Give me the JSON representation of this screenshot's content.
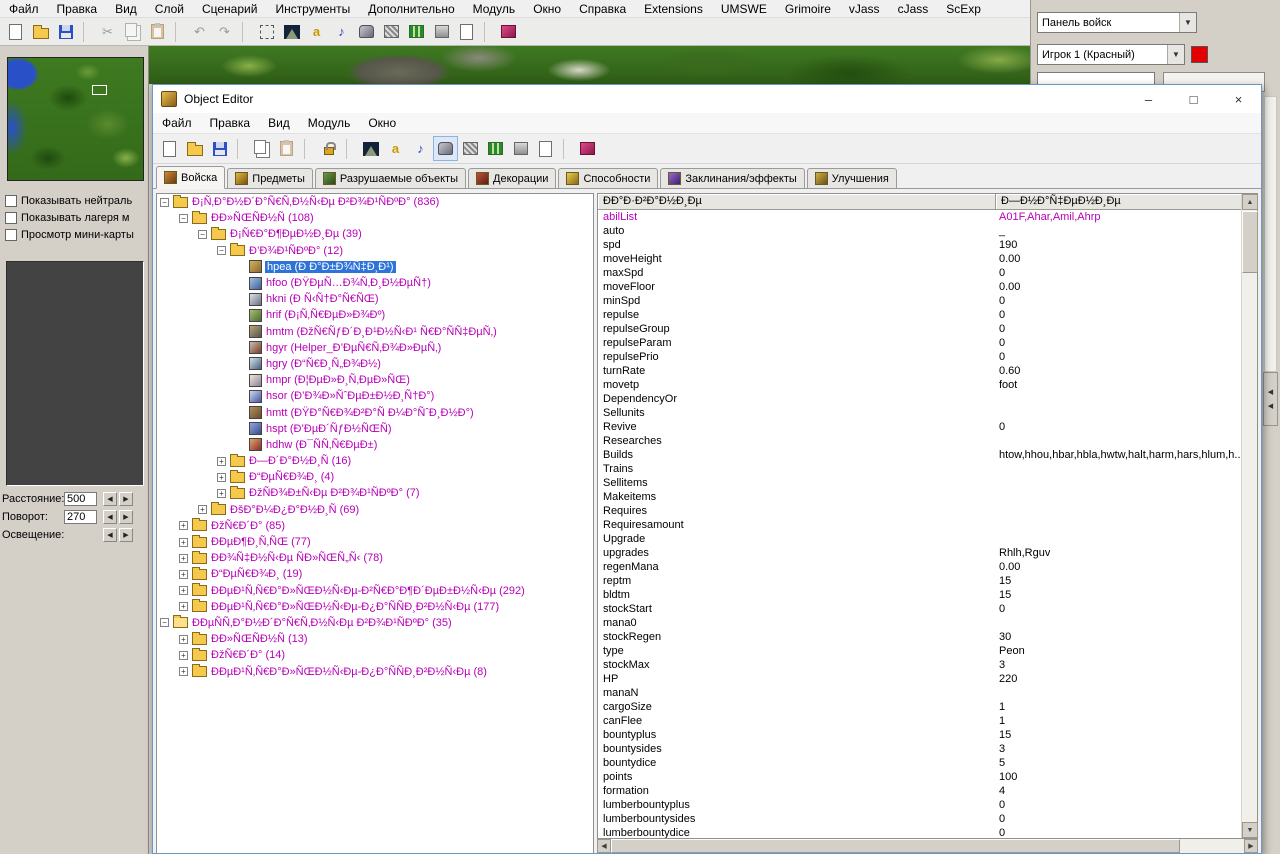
{
  "icons": {
    "dropdown": "▼",
    "minimize": "–",
    "maximize": "□",
    "close": "×",
    "scroll_up": "▲",
    "scroll_down": "▼",
    "scroll_left": "◀",
    "scroll_right": "▶",
    "spin_left": "◀",
    "spin_right": "▶",
    "expand_plus": "+",
    "expand_minus": "−"
  },
  "main_menu": {
    "items": [
      "Файл",
      "Правка",
      "Вид",
      "Слой",
      "Сценарий",
      "Инструменты",
      "Дополнительно",
      "Модуль",
      "Окно",
      "Справка",
      "Extensions",
      "UMSWE",
      "Grimoire",
      "vJass",
      "cJass",
      "ScExp"
    ]
  },
  "main_toolbar": [
    {
      "name": "new-document-icon",
      "kind": "page"
    },
    {
      "name": "open-folder-icon",
      "kind": "folder"
    },
    {
      "name": "save-icon",
      "kind": "floppy"
    },
    {
      "sep": true
    },
    {
      "name": "cut-icon",
      "kind": "glyph",
      "glyph": "✂",
      "color": "#9a9a9a"
    },
    {
      "name": "copy-icon",
      "kind": "copy",
      "dim": true
    },
    {
      "name": "paste-icon",
      "kind": "paste",
      "dim": true
    },
    {
      "sep": true
    },
    {
      "name": "undo-icon",
      "kind": "glyph",
      "glyph": "↶",
      "color": "#9a9a9a"
    },
    {
      "name": "redo-icon",
      "kind": "glyph",
      "glyph": "↷",
      "color": "#9a9a9a"
    },
    {
      "sep": true
    },
    {
      "name": "selection-frame-icon",
      "kind": "dash"
    },
    {
      "name": "terrain-palette-icon",
      "kind": "mountain"
    },
    {
      "name": "trigger-editor-icon",
      "kind": "glyph",
      "glyph": "a",
      "color": "#c89a00",
      "bold": true
    },
    {
      "name": "sound-editor-icon",
      "kind": "glyph",
      "glyph": "♪",
      "color": "#2a4ac0"
    },
    {
      "name": "object-editor-icon",
      "kind": "helmet"
    },
    {
      "name": "campaign-editor-icon",
      "kind": "rails"
    },
    {
      "name": "object-manager-icon",
      "kind": "gridg"
    },
    {
      "name": "import-manager-icon",
      "kind": "box"
    },
    {
      "name": "script-editor-icon",
      "kind": "page"
    },
    {
      "sep": true
    },
    {
      "name": "test-map-icon",
      "kind": "palette"
    }
  ],
  "top_right": {
    "palette_dropdown": "Панель войск",
    "player_dropdown": "Игрок 1 (Красный)",
    "player_color": "#e40000"
  },
  "left_panel": {
    "checkboxes": [
      "Показывать нейтраль",
      "Показывать лагеря м",
      "Просмотр мини-карты"
    ],
    "fields": [
      {
        "label": "Расстояние:",
        "value": "500",
        "has_input": true
      },
      {
        "label": "Поворот:",
        "value": "270",
        "has_input": true
      },
      {
        "label": "Освещение:",
        "value": "",
        "has_input": false
      }
    ]
  },
  "object_editor": {
    "title": "Object Editor",
    "menu": [
      "Файл",
      "Правка",
      "Вид",
      "Модуль",
      "Окно"
    ],
    "toolbar": [
      {
        "name": "new-document-icon",
        "kind": "page"
      },
      {
        "name": "open-folder-icon",
        "kind": "folder"
      },
      {
        "name": "save-icon",
        "kind": "floppy"
      },
      {
        "sep": true
      },
      {
        "name": "copy-icon",
        "kind": "copy"
      },
      {
        "name": "paste-icon",
        "kind": "paste",
        "dim": true
      },
      {
        "sep": true
      },
      {
        "name": "lock-icon",
        "kind": "lock"
      },
      {
        "sep": true
      },
      {
        "name": "terrain-editor-icon",
        "kind": "mountain"
      },
      {
        "name": "trigger-editor-icon",
        "kind": "glyph",
        "glyph": "a",
        "color": "#c89a00",
        "bold": true
      },
      {
        "name": "sound-editor-icon",
        "kind": "glyph",
        "glyph": "♪",
        "color": "#2a4ac0"
      },
      {
        "name": "object-editor-icon",
        "kind": "helmet",
        "pressed": true
      },
      {
        "name": "campaign-editor-icon",
        "kind": "rails"
      },
      {
        "name": "object-manager-icon",
        "kind": "gridg"
      },
      {
        "name": "import-manager-icon",
        "kind": "box"
      },
      {
        "name": "script-editor-icon",
        "kind": "page"
      },
      {
        "sep": true
      },
      {
        "name": "test-map-icon",
        "kind": "palette"
      }
    ],
    "tabs": [
      {
        "label": "Войска",
        "active": true,
        "c1": "#d08a3a",
        "c2": "#6a3a10"
      },
      {
        "label": "Предметы",
        "c1": "#e0b840",
        "c2": "#7a5210"
      },
      {
        "label": "Разрушаемые объекты",
        "c1": "#6a9a4a",
        "c2": "#2a4a18"
      },
      {
        "label": "Декорации",
        "c1": "#c05038",
        "c2": "#5a2012"
      },
      {
        "label": "Способности",
        "c1": "#e8cc50",
        "c2": "#8a6a14"
      },
      {
        "label": "Заклинания/эффекты",
        "c1": "#9a68d0",
        "c2": "#3a2070"
      },
      {
        "label": "Улучшения",
        "c1": "#d0b048",
        "c2": "#6a5214"
      }
    ],
    "tree": [
      {
        "l": 0,
        "t": "f",
        "e": "-",
        "label": "Ð¡Ñ‚Ð°Ð½Ð´Ð°Ñ€Ñ‚Ð½Ñ‹Ðµ Ð²Ð¾Ð¹ÑÐºÐ° (836)"
      },
      {
        "l": 1,
        "t": "f",
        "e": "-",
        "label": "ÐÐ»ÑŒÑÐ½Ñ (108)"
      },
      {
        "l": 2,
        "t": "f",
        "e": "-",
        "label": "Ð¡Ñ€Ð°Ð¶ÐµÐ½Ð¸Ðµ (39)"
      },
      {
        "l": 3,
        "t": "f",
        "e": "-",
        "label": "Ð’Ð¾Ð¹ÑÐºÐ° (12)"
      },
      {
        "l": 4,
        "t": "u",
        "s": true,
        "c1": "#8a6a2e",
        "c2": "#d8b060",
        "label": "hpea (Ð Ð°Ð±Ð¾Ñ‡Ð¸Ð¹)"
      },
      {
        "l": 4,
        "t": "u",
        "c1": "#3a5f9f",
        "c2": "#a8c0e0",
        "label": "hfoo (ÐŸÐµÑ…Ð¾Ñ‚Ð¸Ð½ÐµÑ†)"
      },
      {
        "l": 4,
        "t": "u",
        "c1": "#6a7080",
        "c2": "#e0e0ea",
        "label": "hkni (Ð Ñ‹Ñ†Ð°Ñ€ÑŒ)"
      },
      {
        "l": 4,
        "t": "u",
        "c1": "#4a6a30",
        "c2": "#a8c070",
        "label": "hrif (Ð¡Ñ‚Ñ€ÐµÐ»Ð¾Ðº)"
      },
      {
        "l": 4,
        "t": "u",
        "c1": "#55544e",
        "c2": "#b8a878",
        "label": "hmtm (ÐžÑ€ÑƒÐ´Ð¸Ð¹Ð½Ñ‹Ð¹ Ñ€Ð°ÑÑ‡ÐµÑ‚)"
      },
      {
        "l": 4,
        "t": "u",
        "c1": "#7a3a28",
        "c2": "#c8c0b0",
        "label": "hgyr (Helper_Ð’ÐµÑ€Ñ‚Ð¾Ð»ÐµÑ‚)"
      },
      {
        "l": 4,
        "t": "u",
        "c1": "#47617d",
        "c2": "#d8e0ee",
        "label": "hgry (Ð“Ñ€Ð¸Ñ„Ð¾Ð½)"
      },
      {
        "l": 4,
        "t": "u",
        "c1": "#8a8098",
        "c2": "#f0e8da",
        "label": "hmpr (Ð¦ÐµÐ»Ð¸Ñ‚ÐµÐ»ÑŒ)"
      },
      {
        "l": 4,
        "t": "u",
        "c1": "#4656a0",
        "c2": "#d0d8f0",
        "label": "hsor (Ð’Ð¾Ð»ÑˆÐµÐ±Ð½Ð¸Ñ†Ð°)"
      },
      {
        "l": 4,
        "t": "u",
        "c1": "#6a4a28",
        "c2": "#b09060",
        "label": "hmtt (ÐŸÐ°Ñ€Ð¾Ð²Ð°Ñ Ð¼Ð°ÑˆÐ¸Ð½Ð°)"
      },
      {
        "l": 4,
        "t": "u",
        "c1": "#3a4a8a",
        "c2": "#92a8e0",
        "label": "hspt (Ð’ÐµÐ´ÑƒÐ½ÑŒÑ)"
      },
      {
        "l": 4,
        "t": "u",
        "c1": "#8a2a2a",
        "c2": "#e0a868",
        "label": "hdhw (Ð¯ÑÑ‚Ñ€ÐµÐ±)"
      },
      {
        "l": 3,
        "t": "f",
        "e": "+",
        "label": "Ð—Ð´Ð°Ð½Ð¸Ñ (16)"
      },
      {
        "l": 3,
        "t": "f",
        "e": "+",
        "label": "Ð“ÐµÑ€Ð¾Ð¸ (4)"
      },
      {
        "l": 3,
        "t": "f",
        "e": "+",
        "label": "ÐžÑÐ¾Ð±Ñ‹Ðµ Ð²Ð¾Ð¹ÑÐºÐ° (7)"
      },
      {
        "l": 2,
        "t": "f",
        "e": "+",
        "label": "ÐšÐ°Ð¼Ð¿Ð°Ð½Ð¸Ñ (69)"
      },
      {
        "l": 1,
        "t": "f",
        "e": "+",
        "label": "ÐžÑ€Ð´Ð° (85)"
      },
      {
        "l": 1,
        "t": "f",
        "e": "+",
        "label": "ÐÐµÐ¶Ð¸Ñ‚ÑŒ (77)"
      },
      {
        "l": 1,
        "t": "f",
        "e": "+",
        "label": "ÐÐ¾Ñ‡Ð½Ñ‹Ðµ ÑÐ»ÑŒÑ„Ñ‹ (78)"
      },
      {
        "l": 1,
        "t": "f",
        "e": "+",
        "label": "Ð“ÐµÑ€Ð¾Ð¸ (19)"
      },
      {
        "l": 1,
        "t": "f",
        "e": "+",
        "label": "ÐÐµÐ¹Ñ‚Ñ€Ð°Ð»ÑŒÐ½Ñ‹Ðµ-Ð²Ñ€Ð°Ð¶Ð´ÐµÐ±Ð½Ñ‹Ðµ (292)"
      },
      {
        "l": 1,
        "t": "f",
        "e": "+",
        "label": "ÐÐµÐ¹Ñ‚Ñ€Ð°Ð»ÑŒÐ½Ñ‹Ðµ-Ð¿Ð°ÑÑÐ¸Ð²Ð½Ñ‹Ðµ (177)"
      },
      {
        "l": 0,
        "t": "fo",
        "e": "-",
        "label": "ÐÐµÑÑ‚Ð°Ð½Ð´Ð°Ñ€Ñ‚Ð½Ñ‹Ðµ Ð²Ð¾Ð¹ÑÐºÐ° (35)"
      },
      {
        "l": 1,
        "t": "f",
        "e": "+",
        "label": "ÐÐ»ÑŒÑÐ½Ñ (13)"
      },
      {
        "l": 1,
        "t": "f",
        "e": "+",
        "label": "ÐžÑ€Ð´Ð° (14)"
      },
      {
        "l": 1,
        "t": "f",
        "e": "+",
        "label": "ÐÐµÐ¹Ñ‚Ñ€Ð°Ð»ÑŒÐ½Ñ‹Ðµ-Ð¿Ð°ÑÑÐ¸Ð²Ð½Ñ‹Ðµ (8)"
      }
    ],
    "grid": {
      "name_header": "ÐÐ°Ð·Ð²Ð°Ð½Ð¸Ðµ",
      "value_header": "Ð—Ð½Ð°Ñ‡ÐµÐ½Ð¸Ðµ",
      "rows": [
        {
          "n": "abilList",
          "v": "A01F,Ahar,Amil,Ahrp",
          "m": true
        },
        {
          "n": "auto",
          "v": "_"
        },
        {
          "n": "spd",
          "v": "190"
        },
        {
          "n": "moveHeight",
          "v": "0.00"
        },
        {
          "n": "maxSpd",
          "v": "0"
        },
        {
          "n": "moveFloor",
          "v": "0.00"
        },
        {
          "n": "minSpd",
          "v": "0"
        },
        {
          "n": "repulse",
          "v": "0"
        },
        {
          "n": "repulseGroup",
          "v": "0"
        },
        {
          "n": "repulseParam",
          "v": "0"
        },
        {
          "n": "repulsePrio",
          "v": "0"
        },
        {
          "n": "turnRate",
          "v": "0.60"
        },
        {
          "n": "movetp",
          "v": "foot"
        },
        {
          "n": "DependencyOr",
          "v": ""
        },
        {
          "n": "Sellunits",
          "v": ""
        },
        {
          "n": "Revive",
          "v": "0"
        },
        {
          "n": "Researches",
          "v": ""
        },
        {
          "n": "Builds",
          "v": "htow,hhou,hbar,hbla,hwtw,halt,harm,hars,hlum,h..."
        },
        {
          "n": "Trains",
          "v": ""
        },
        {
          "n": "Sellitems",
          "v": ""
        },
        {
          "n": "Makeitems",
          "v": ""
        },
        {
          "n": "Requires",
          "v": ""
        },
        {
          "n": "Requiresamount",
          "v": ""
        },
        {
          "n": "Upgrade",
          "v": ""
        },
        {
          "n": "upgrades",
          "v": "Rhlh,Rguv"
        },
        {
          "n": "regenMana",
          "v": "0.00"
        },
        {
          "n": "reptm",
          "v": "15"
        },
        {
          "n": "bldtm",
          "v": "15"
        },
        {
          "n": "stockStart",
          "v": "0"
        },
        {
          "n": "mana0",
          "v": ""
        },
        {
          "n": "stockRegen",
          "v": "30"
        },
        {
          "n": "type",
          "v": "Peon"
        },
        {
          "n": "stockMax",
          "v": "3"
        },
        {
          "n": "HP",
          "v": "220"
        },
        {
          "n": "manaN",
          "v": ""
        },
        {
          "n": "cargoSize",
          "v": "1"
        },
        {
          "n": "canFlee",
          "v": "1"
        },
        {
          "n": "bountyplus",
          "v": "15"
        },
        {
          "n": "bountysides",
          "v": "3"
        },
        {
          "n": "bountydice",
          "v": "5"
        },
        {
          "n": "points",
          "v": "100"
        },
        {
          "n": "formation",
          "v": "4"
        },
        {
          "n": "lumberbountyplus",
          "v": "0"
        },
        {
          "n": "lumberbountysides",
          "v": "0"
        },
        {
          "n": "lumberbountydice",
          "v": "0"
        }
      ]
    }
  }
}
